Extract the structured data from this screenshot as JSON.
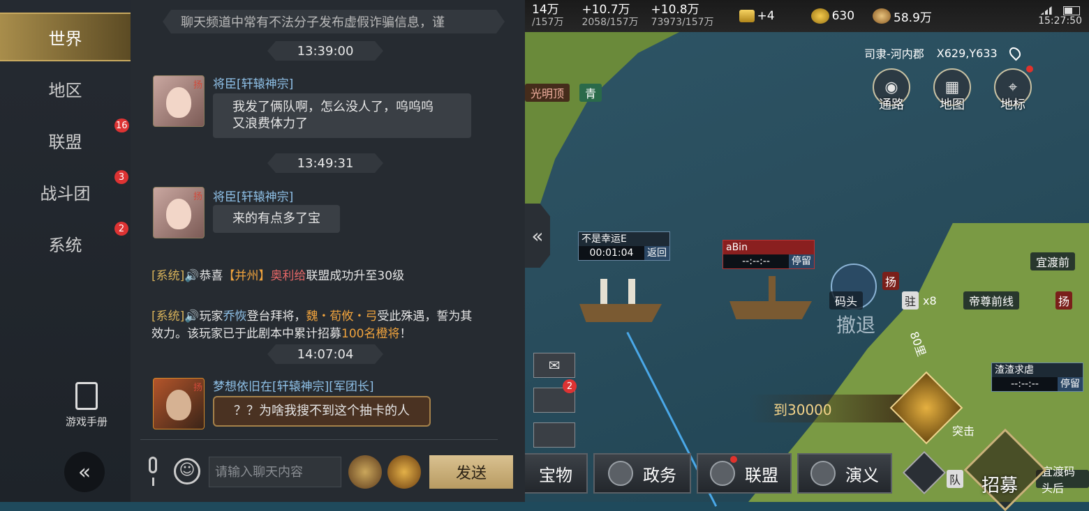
{
  "sidebar": {
    "tabs": [
      {
        "label": "世界",
        "active": true,
        "badge": ""
      },
      {
        "label": "地区",
        "active": false,
        "badge": ""
      },
      {
        "label": "联盟",
        "active": false,
        "badge": "16"
      },
      {
        "label": "战斗团",
        "active": false,
        "badge": "3"
      },
      {
        "label": "系统",
        "active": false,
        "badge": "2"
      }
    ],
    "manual_label": "游戏手册",
    "collapse_glyph": "«"
  },
  "chat": {
    "notice": "聊天频道中常有不法分子发布虚假诈骗信息，谨",
    "times": [
      "13:39:00",
      "13:49:31",
      "14:07:04"
    ],
    "messages": [
      {
        "name": "将臣[轩辕神宗]",
        "tag": "扬",
        "text_line1": "我发了俩队啊，怎么没人了，呜呜呜",
        "text_line2": "又浪费体力了"
      },
      {
        "name": "将臣[轩辕神宗]",
        "tag": "扬",
        "text_line1": "来的有点多了宝"
      },
      {
        "name": "梦想依旧在[轩辕神宗][军团长]",
        "tag": "扬",
        "text_line1": "？？为啥我搜不到这个抽卡的人"
      }
    ],
    "system1": {
      "tag": "[系统]",
      "speaker": "🔊",
      "p1": "恭喜",
      "province": "【并州】",
      "alliance": "奥利给",
      "p2": "联盟成功升至30级"
    },
    "system2": {
      "tag": "[系统]",
      "speaker": "🔊",
      "p1": "玩家",
      "player": "乔恢",
      "p2": "登台拜将，",
      "heroes": "魏・荀攸・弓",
      "p3": "受此殊遇，誓为其效力。该玩家已于此剧本中累计招募",
      "count": "100名橙将",
      "p4": "！"
    },
    "input_placeholder": "请输入聊天内容",
    "send_label": "发送"
  },
  "topbar": {
    "resources": [
      {
        "big": "14万",
        "small": "/157万"
      },
      {
        "big": "+10.7万",
        "small": "2058/157万"
      },
      {
        "big": "+10.8万",
        "small": "73973/157万"
      }
    ],
    "gold_bars": "+4",
    "coins": "630",
    "copper": "58.9万",
    "clock": "15:27:50"
  },
  "location": {
    "region": "司隶-河内郡",
    "coords": "X629,Y633"
  },
  "map_buttons": [
    "通路",
    "地图",
    "地标"
  ],
  "map": {
    "march1": {
      "name": "不是幸运E",
      "timer": "00:01:04",
      "action": "返回"
    },
    "march2": {
      "name": "aBin",
      "timer": "--:--:--",
      "action": "停留"
    },
    "march3": {
      "name": "渣渣求虐",
      "timer": "--:--:--",
      "action": "停留"
    },
    "pier_label": "码头",
    "pier_tag": "扬",
    "garrison_label": "驻",
    "garrison_count": "x8",
    "label_yidu": "宜渡前",
    "label_dizun": "帝尊前线",
    "label_yidu_pier": "宜渡码头后",
    "label_breakout": "突击",
    "label_distance": "80里",
    "reward": "到30000",
    "label_guangming": "光明顶",
    "label_qing": "青",
    "mail_badge": "2",
    "withdraw": "撤退",
    "team_chip": "队"
  },
  "bottom_menu": [
    "宝物",
    "政务",
    "联盟",
    "演义"
  ],
  "recruit_label": "招募",
  "collapse_right_glyph": "«"
}
